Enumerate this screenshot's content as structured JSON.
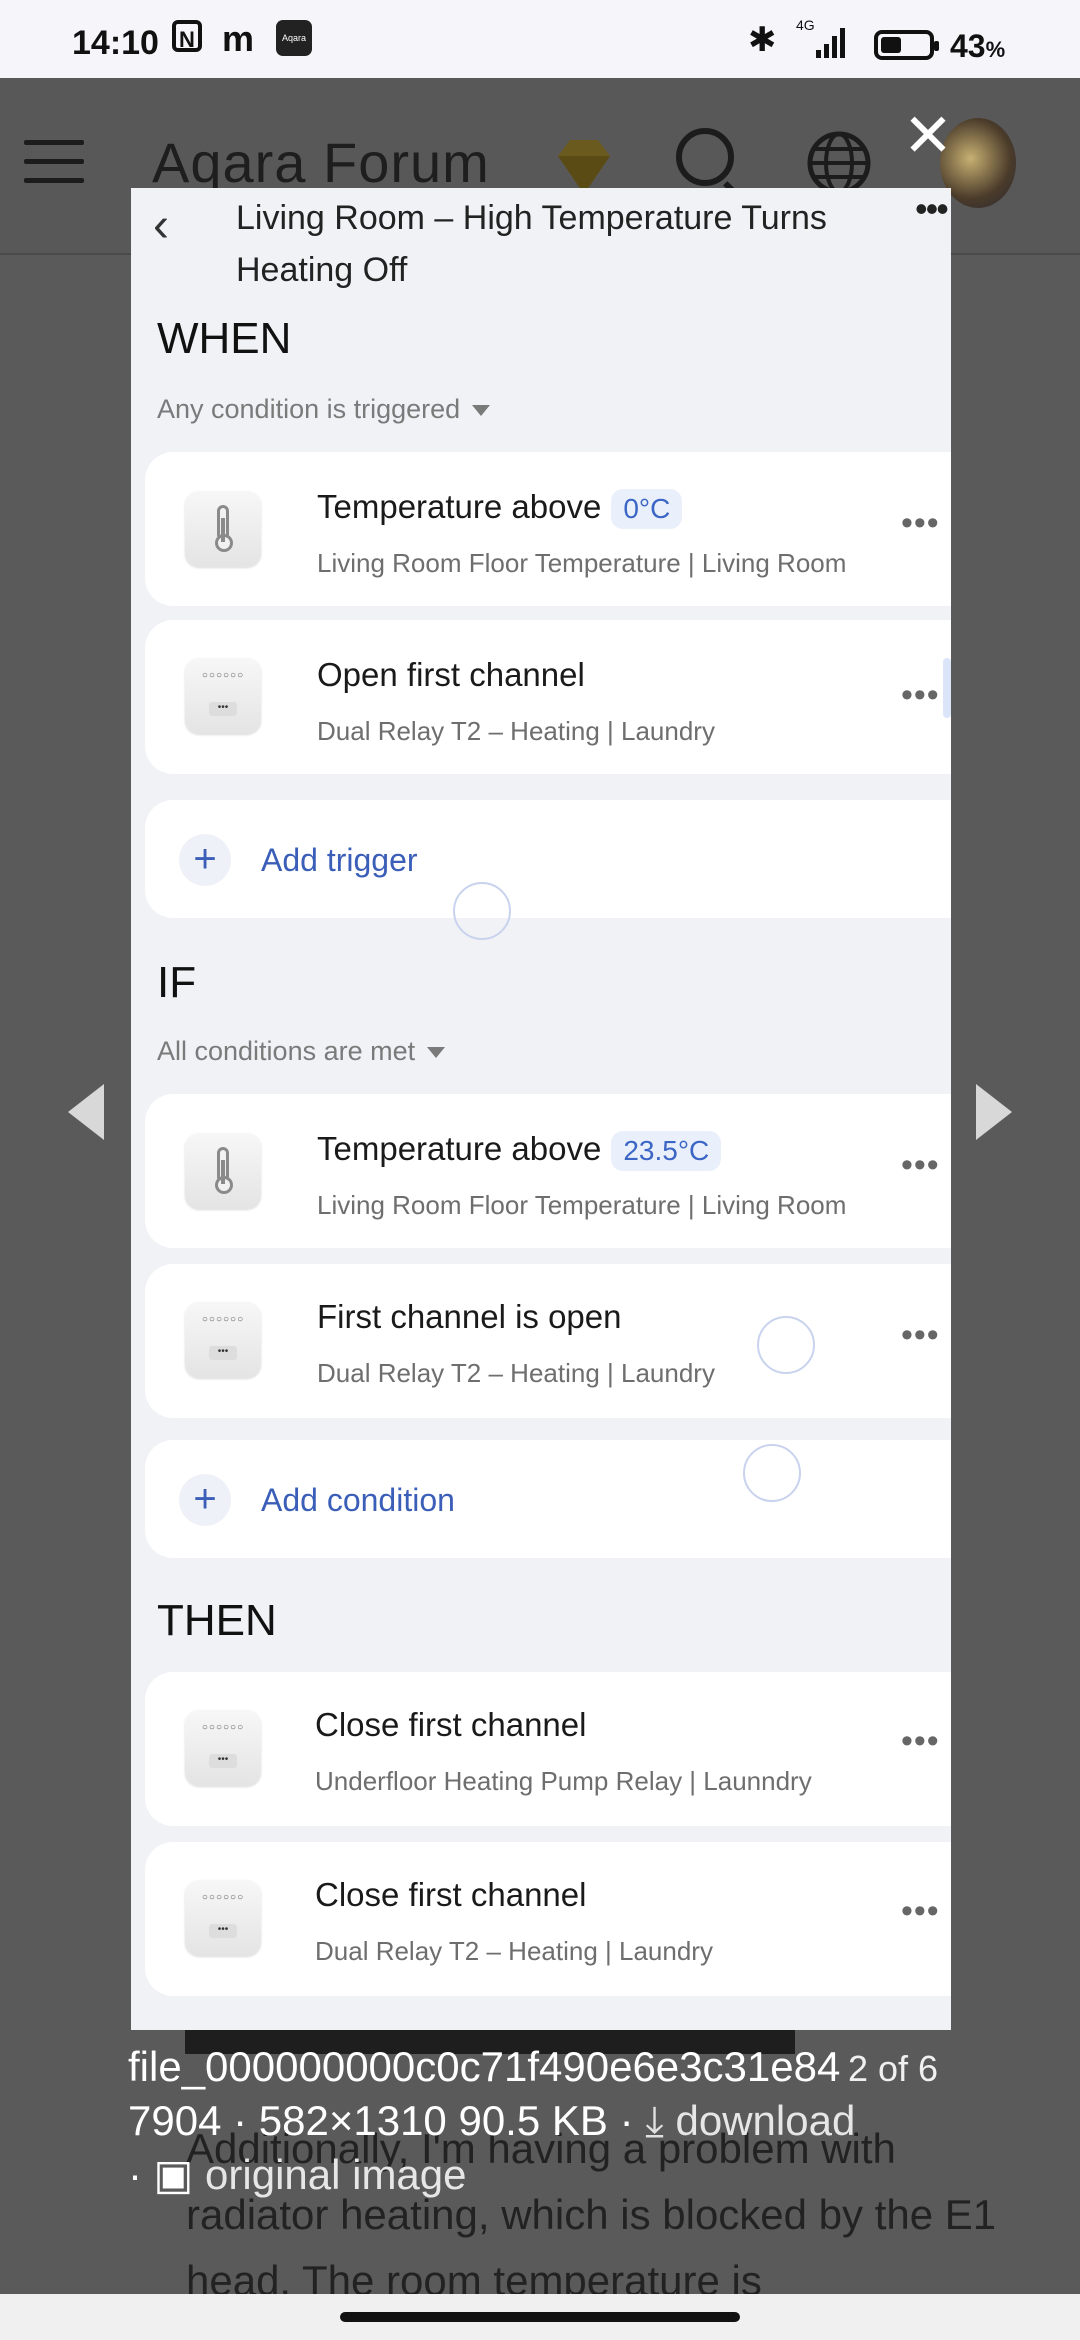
{
  "status_bar": {
    "time": "14:10",
    "icons": [
      "n-icon",
      "m-icon",
      "aqara-app-icon",
      "bluetooth-icon",
      "signal-4g-icon",
      "battery-icon"
    ],
    "network": "4G",
    "battery_percent": "43",
    "battery_unit": "%"
  },
  "forum_header": {
    "logo": "Aqara Forum",
    "close_symbol": "✕"
  },
  "automation": {
    "title": "Living Room – High Temperature Turns Heating Off",
    "menu_symbol": "•••",
    "when": {
      "heading": "WHEN",
      "mode": "Any condition is triggered",
      "items": [
        {
          "title": "Temperature above",
          "badge": "0°C",
          "subtitle": "Living Room Floor Temperature | Living Room",
          "icon": "thermometer-icon"
        },
        {
          "title": "Open first channel",
          "subtitle": "Dual Relay T2 – Heating | Laundry",
          "icon": "relay-icon"
        }
      ],
      "add_label": "Add trigger"
    },
    "if": {
      "heading": "IF",
      "mode": "All conditions are met",
      "items": [
        {
          "title": "Temperature above",
          "badge": "23.5°C",
          "subtitle": "Living Room Floor Temperature | Living Room",
          "icon": "thermometer-icon"
        },
        {
          "title": "First channel is open",
          "subtitle": "Dual Relay T2 – Heating | Laundry",
          "icon": "relay-icon"
        }
      ],
      "add_label": "Add condition"
    },
    "then": {
      "heading": "THEN",
      "items": [
        {
          "title": "Close first channel",
          "subtitle": "Underfloor Heating Pump Relay | Launndry",
          "icon": "relay-icon"
        },
        {
          "title": "Close first channel",
          "subtitle": "Dual Relay T2 – Heating | Laundry",
          "icon": "relay-icon"
        }
      ]
    },
    "more_symbol": "•••",
    "plus_symbol": "+",
    "relay_dots": "○○○○○○",
    "relay_button": "•••"
  },
  "caption": {
    "filename_line1": "file_000000000c0c71f490e6e3c31e84",
    "filename_line2": "7904 · 582×1310 90.5 KB · ",
    "download": "download",
    "original": "original image",
    "counter": "2 of 6",
    "dot": "·"
  },
  "background_article": {
    "text": "Additionally, I'm having a problem with radiator heating, which is blocked by the E1 head. The room temperature is"
  }
}
